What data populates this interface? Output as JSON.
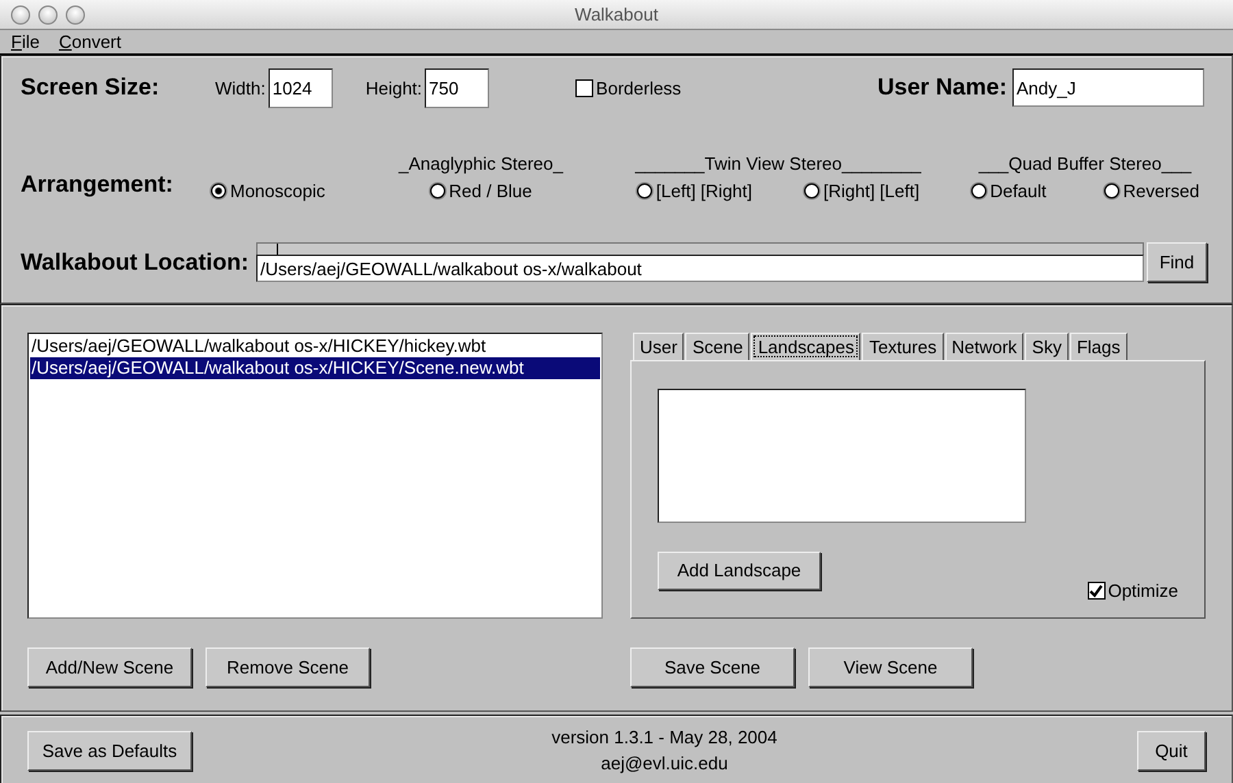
{
  "window": {
    "title": "Walkabout"
  },
  "menu": [
    "File",
    "Convert"
  ],
  "screen_size": {
    "label": "Screen Size:",
    "width_label": "Width:",
    "width_value": "1024",
    "height_label": "Height:",
    "height_value": "750"
  },
  "borderless": {
    "label": "Borderless",
    "checked": false
  },
  "user_name": {
    "label": "User Name:",
    "value": "Andy_J"
  },
  "arrangement": {
    "label": "Arrangement:",
    "groups": [
      {
        "options": [
          {
            "label": "Monoscopic",
            "selected": true
          }
        ]
      },
      {
        "heading": "_Anaglyphic Stereo_",
        "options": [
          {
            "label": "Red / Blue",
            "selected": false
          }
        ]
      },
      {
        "heading": "_______Twin View Stereo________",
        "options": [
          {
            "label": "[Left] [Right]",
            "selected": false
          },
          {
            "label": "[Right] [Left]",
            "selected": false
          }
        ]
      },
      {
        "heading": "___Quad Buffer Stereo___",
        "options": [
          {
            "label": "Default",
            "selected": false
          },
          {
            "label": "Reversed",
            "selected": false
          }
        ]
      }
    ]
  },
  "location": {
    "label": "Walkabout Location:",
    "value": "/Users/aej/GEOWALL/walkabout os-x/walkabout",
    "button": "Find"
  },
  "scenes": [
    {
      "path": "/Users/aej/GEOWALL/walkabout os-x/HICKEY/hickey.wbt",
      "selected": false
    },
    {
      "path": "/Users/aej/GEOWALL/walkabout os-x/HICKEY/Scene.new.wbt",
      "selected": true
    }
  ],
  "tabs": [
    {
      "label": "User",
      "selected": false
    },
    {
      "label": "Scene",
      "selected": false
    },
    {
      "label": "Landscapes",
      "selected": true
    },
    {
      "label": "Textures",
      "selected": false
    },
    {
      "label": "Network",
      "selected": false
    },
    {
      "label": "Sky",
      "selected": false
    },
    {
      "label": "Flags",
      "selected": false
    }
  ],
  "landscapes": {
    "add_button": "Add Landscape",
    "optimize": {
      "label": "Optimize",
      "checked": true
    }
  },
  "scene_buttons": [
    "Add/New Scene",
    "Remove Scene"
  ],
  "tab_buttons": [
    "Save Scene",
    "View Scene"
  ],
  "footer": {
    "defaults_button": "Save as Defaults",
    "version": "version 1.3.1 - May 28, 2004",
    "email": "aej@evl.uic.edu",
    "quit_button": "Quit"
  }
}
